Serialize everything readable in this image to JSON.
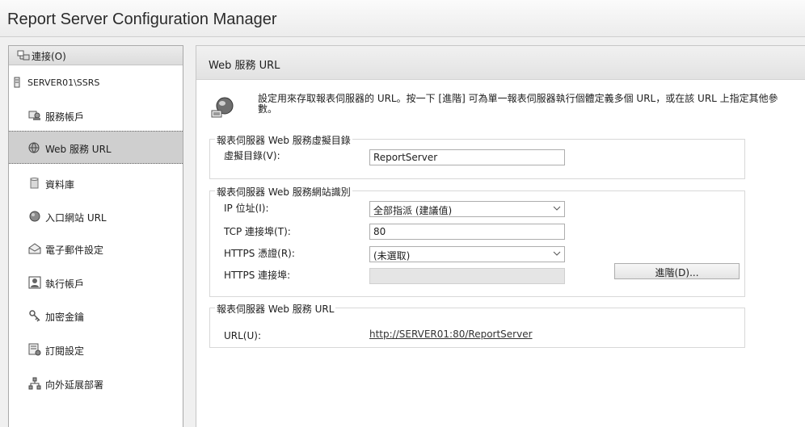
{
  "window": {
    "title": "Report Server Configuration Manager"
  },
  "sidebar": {
    "connect_label": "連接(O)",
    "server_label": "SERVER01\\SSRS",
    "items": [
      {
        "label": "服務帳戶",
        "icon": "service-account-icon",
        "selected": false
      },
      {
        "label": "Web 服務 URL",
        "icon": "web-service-icon",
        "selected": true
      },
      {
        "label": "資料庫",
        "icon": "database-icon",
        "selected": false
      },
      {
        "label": "入口網站 URL",
        "icon": "web-portal-icon",
        "selected": false
      },
      {
        "label": "電子郵件設定",
        "icon": "email-icon",
        "selected": false
      },
      {
        "label": "執行帳戶",
        "icon": "execution-account-icon",
        "selected": false
      },
      {
        "label": "加密金鑰",
        "icon": "encryption-keys-icon",
        "selected": false
      },
      {
        "label": "訂閱設定",
        "icon": "subscription-icon",
        "selected": false
      },
      {
        "label": "向外延展部署",
        "icon": "scale-out-icon",
        "selected": false
      }
    ]
  },
  "main": {
    "header": "Web 服務 URL",
    "intro": "設定用來存取報表伺服器的 URL。按一下 [進階] 可為單一報表伺服器執行個體定義多個 URL，或在該 URL 上指定其他參數。",
    "virtual_dir": {
      "legend": "報表伺服器 Web 服務虛擬目錄",
      "label": "虛擬目錄(V):",
      "value": "ReportServer"
    },
    "site_id": {
      "legend": "報表伺服器 Web 服務網站識別",
      "ip_label": "IP 位址(I):",
      "ip_value": "全部指派 (建議值)",
      "tcp_label": "TCP 連接埠(T):",
      "tcp_value": "80",
      "cert_label": "HTTPS 憑證(R):",
      "cert_value": "(未選取)",
      "https_port_label": "HTTPS 連接埠:",
      "https_port_value": "",
      "advanced_label": "進階(D)..."
    },
    "urls": {
      "legend": "報表伺服器 Web 服務 URL",
      "label": "URL(U):",
      "link": "http://SERVER01:80/ReportServer"
    }
  }
}
